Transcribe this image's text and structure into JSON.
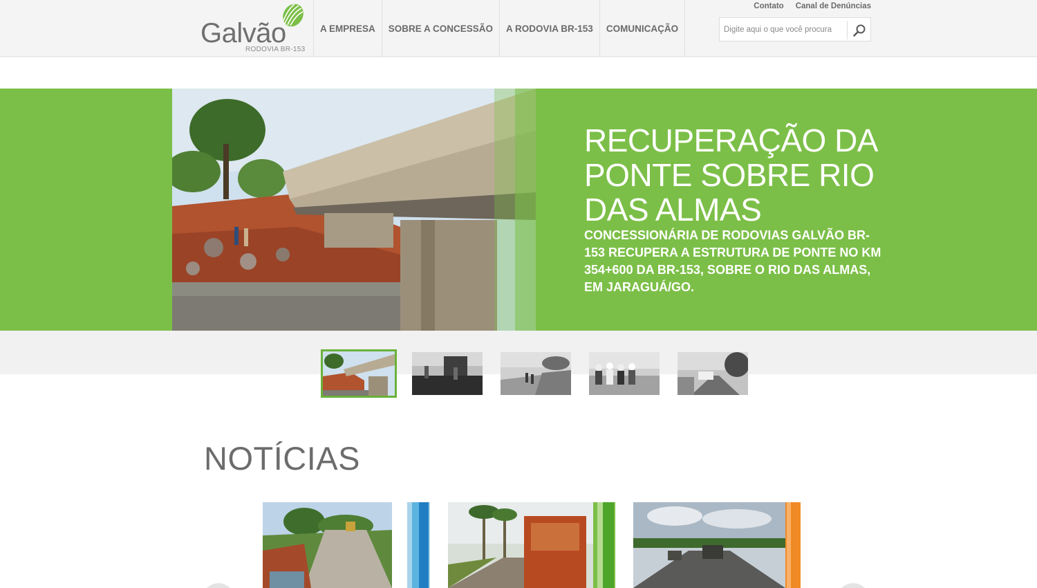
{
  "header": {
    "logo": {
      "name": "Galvão",
      "subtitle": "RODOVIA BR-153",
      "colors": {
        "text": "#6f6f6f",
        "leaf": "#7cbf48"
      }
    },
    "nav": [
      {
        "label": "A EMPRESA"
      },
      {
        "label": "SOBRE A CONCESSÃO"
      },
      {
        "label": "A RODOVIA BR-153"
      },
      {
        "label": "COMUNICAÇÃO"
      }
    ],
    "top_links": [
      {
        "label": "Contato"
      },
      {
        "label": "Canal de Denúncias"
      }
    ],
    "search": {
      "placeholder": "Digite aqui o que você procura",
      "value": "",
      "icon": "search-icon"
    }
  },
  "hero": {
    "title": "RECUPERAÇÃO DA PONTE SOBRE RIO DAS ALMAS",
    "subtitle": "CONCESSIONÁRIA DE RODOVIAS GALVÃO BR-153 RECUPERA A ESTRUTURA DE PONTE NO KM 354+600 DA BR-153, SOBRE O RIO DAS ALMAS, EM JARAGUÁ/GO.",
    "background_color": "#7cbf48",
    "thumbnails": [
      {
        "id": "bridge",
        "active": true
      },
      {
        "id": "paving-crew",
        "active": false
      },
      {
        "id": "roadside-workers",
        "active": false
      },
      {
        "id": "team-photo",
        "active": false
      },
      {
        "id": "highway-trucks",
        "active": false
      }
    ]
  },
  "news": {
    "section_title": "NOTÍCIAS",
    "cards": [
      {
        "id": "road-construction",
        "accent": "#2a9bd4"
      },
      {
        "id": "truck-palms",
        "accent": "#7cbf48"
      },
      {
        "id": "paving-machines",
        "accent": "#f08a24"
      }
    ]
  },
  "colors": {
    "accent_green": "#7cbf48",
    "nav_text": "#6a6a6a",
    "active_thumb_border": "#6ab23a"
  }
}
